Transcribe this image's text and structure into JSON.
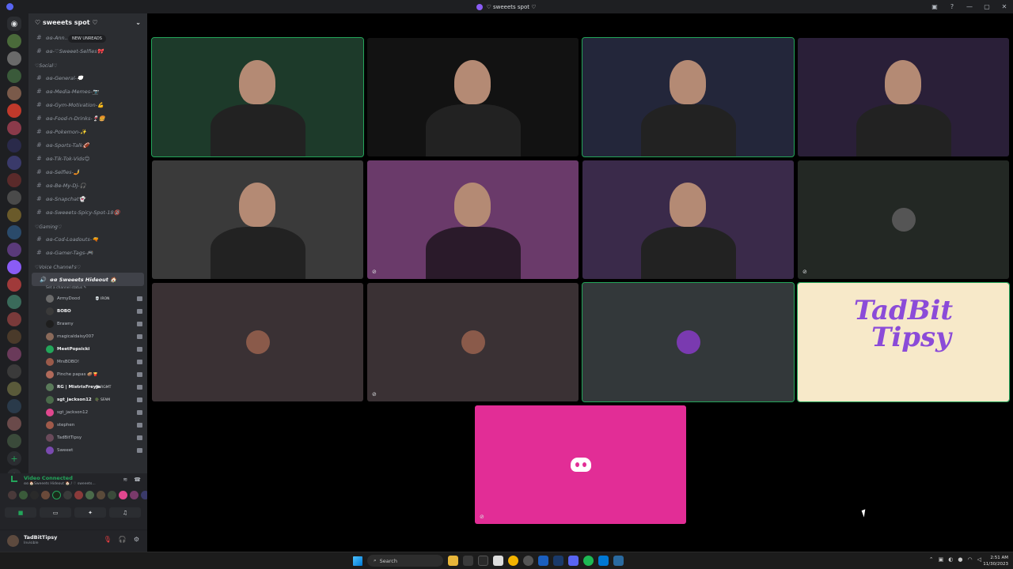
{
  "window": {
    "title": "♡ sweeets spot ♡",
    "controls": [
      "—",
      "▢",
      "✕"
    ]
  },
  "server": {
    "name": "♡ sweeets spot ♡",
    "new_unreads_label": "NEW UNREADS"
  },
  "channels_top": [
    {
      "name": "ɞɞ-Ann..."
    },
    {
      "name": "ɞɞ-♡Sweeet-Selfies🎀"
    }
  ],
  "category_social": "♡Social♡",
  "channels_social": [
    {
      "name": "ɞɞ-General-💭"
    },
    {
      "name": "ɞɞ-Media-Memes-📷"
    },
    {
      "name": "ɞɞ-Gym-Motivation-💪"
    },
    {
      "name": "ɞɞ-Food-n-Drinks-🍷🍔"
    },
    {
      "name": "ɞɞ-Pokemon-✨"
    },
    {
      "name": "ɞɞ-Sports-Talk🏈"
    },
    {
      "name": "ɞɞ-Tik-Tok-Vids😊"
    },
    {
      "name": "ɞɞ-Selfies-🤳"
    },
    {
      "name": "ɞɞ-Be-My-Dj-🎧"
    },
    {
      "name": "ɞɞ-Snapchat👻"
    },
    {
      "name": "ɞɞ-Sweeets-Spicy-Spot-18🔞"
    }
  ],
  "category_gaming": "♡Gaming♡",
  "channels_gaming": [
    {
      "name": "ɞɞ-Cod-Loadouts-🔫"
    },
    {
      "name": "ɞɞ-Gamer-Tags-🎮"
    }
  ],
  "category_voice": "♡Voice Channel's♡",
  "voice_channel": {
    "name": "ɞɞ Sweeets Hideout 🏠",
    "status": "Set a channel status ✎"
  },
  "voice_users": [
    {
      "name": "ArmyDood",
      "tag": "💀 IRON",
      "bold": false,
      "color": "#6b6b6b"
    },
    {
      "name": "BOBO",
      "tag": "",
      "bold": true,
      "color": "#3a3a3a"
    },
    {
      "name": "Brawny",
      "tag": "",
      "bold": false,
      "color": "#1e1e1e"
    },
    {
      "name": "magicaldaisy007",
      "tag": "",
      "bold": false,
      "color": "#8a6a5a"
    },
    {
      "name": "MeetPopsicki",
      "tag": "",
      "bold": true,
      "color": "#23a55a"
    },
    {
      "name": "MrsBOBO!",
      "tag": "",
      "bold": false,
      "color": "#9a5a4a"
    },
    {
      "name": "Pinche papas 🥔🍟",
      "tag": "",
      "bold": false,
      "color": "#b06a5a"
    },
    {
      "name": "RG | MistrixFreyja",
      "tag": "🛡 RGMT",
      "bold": true,
      "color": "#5a7a5a"
    },
    {
      "name": "sgt_jackson12",
      "tag": "🪖 SFAM",
      "bold": true,
      "color": "#4a6a4a"
    },
    {
      "name": "sgt_jackson12",
      "tag": "",
      "bold": false,
      "color": "#e0478e"
    },
    {
      "name": "stephen",
      "tag": "",
      "bold": false,
      "color": "#a05a4a"
    },
    {
      "name": "TadBitTipsy",
      "tag": "",
      "bold": false,
      "color": "#6a4a5a"
    },
    {
      "name": "Sweeet",
      "tag": "",
      "bold": false,
      "color": "#7a4ab0"
    }
  ],
  "voice_panel": {
    "title": "Video Connected",
    "subtitle": "ɞɞ 🏠Sweeets Hideout 🏠 / ♡ sweeets..."
  },
  "user_panel": {
    "name": "TadBitTipsy",
    "status": "Invisible"
  },
  "tiles": [
    {
      "label": "video-tile-1",
      "bg": "#1d3a2a",
      "speaking": true
    },
    {
      "label": "video-tile-2",
      "bg": "#121212",
      "speaking": false
    },
    {
      "label": "video-tile-3",
      "bg": "#23263a",
      "speaking": true
    },
    {
      "label": "video-tile-4",
      "bg": "#2a1f38",
      "speaking": false
    },
    {
      "label": "video-tile-5",
      "bg": "#3a3a3a",
      "speaking": false
    },
    {
      "label": "video-tile-6",
      "bg": "#6a3a6a",
      "speaking": false
    },
    {
      "label": "video-tile-7",
      "bg": "#3a2a4a",
      "speaking": false
    },
    {
      "label": "video-tile-8",
      "bg": "#232824",
      "speaking": false
    },
    {
      "label": "video-tile-9",
      "bg": "#3a3134",
      "speaking": false
    },
    {
      "label": "video-tile-10",
      "bg": "#3a3134",
      "speaking": false
    },
    {
      "label": "video-tile-11",
      "bg": "#33383a",
      "speaking": true
    },
    {
      "label": "video-tile-12",
      "bg": "#f7e9c9",
      "speaking": true
    },
    {
      "label": "video-tile-13",
      "bg": "#e22d96",
      "speaking": false
    }
  ],
  "logo_tile": {
    "line1": "TadBit",
    "line2": "Tipsy"
  },
  "taskbar": {
    "search_label": "Search",
    "time": "2:51 AM",
    "date": "11/30/2023"
  }
}
